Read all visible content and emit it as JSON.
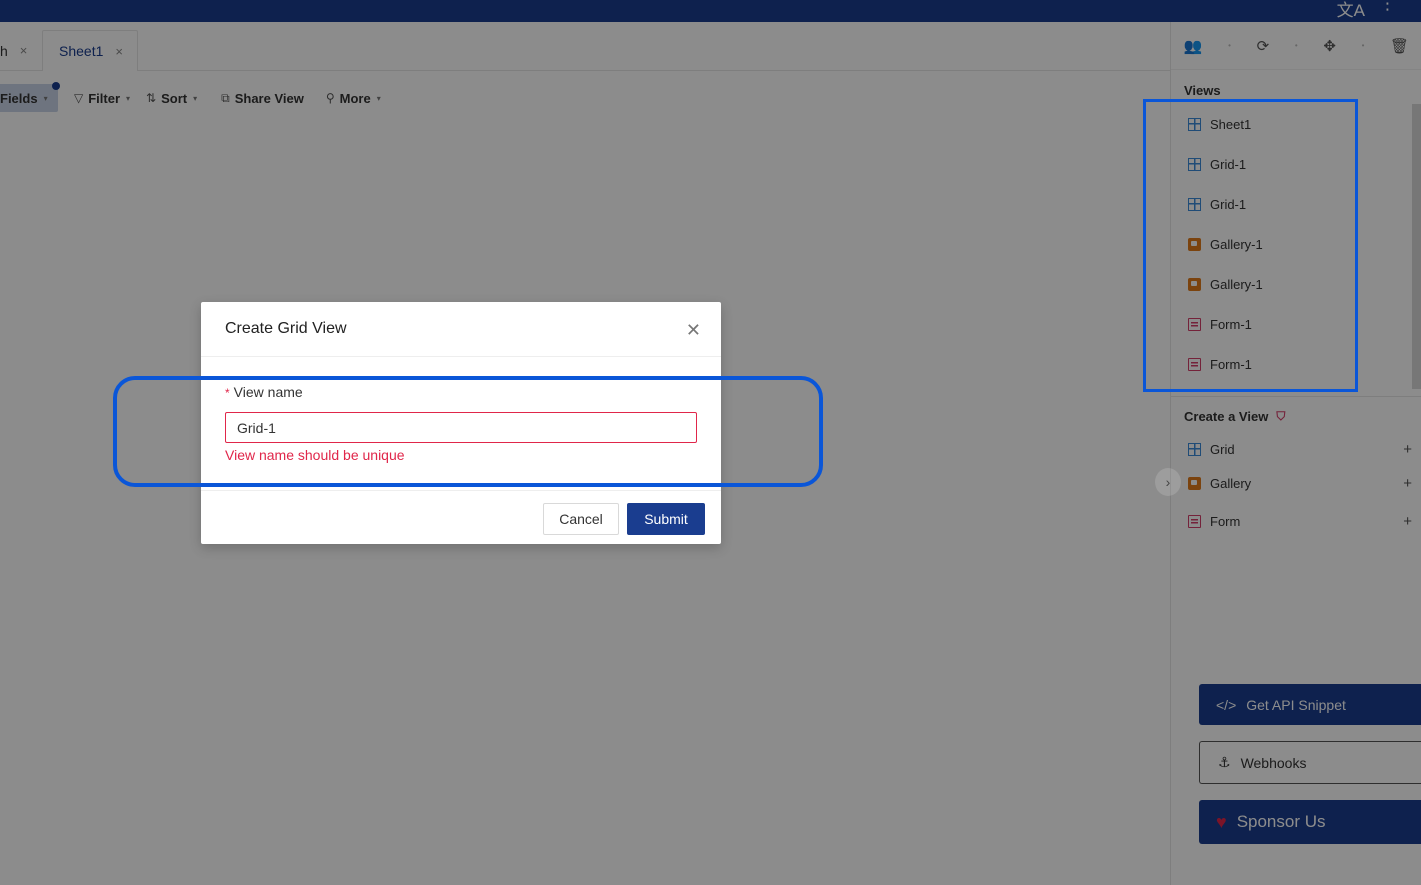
{
  "topbar": {
    "translate_icon": "translate-icon",
    "menu_icon": "more-vertical-icon",
    "translate_glyph": "文A",
    "menu_glyph": "⋮"
  },
  "tabs": {
    "previous_tab_label": "h",
    "active_tab_label": "Sheet1",
    "close_glyph": "×"
  },
  "toolbar": {
    "fields_label": "Fields",
    "filter_label": "Filter",
    "sort_label": "Sort",
    "share_view_label": "Share View",
    "more_label": "More"
  },
  "sidebar": {
    "views_title": "Views",
    "views": [
      {
        "label": "Sheet1",
        "type": "grid"
      },
      {
        "label": "Grid-1",
        "type": "grid"
      },
      {
        "label": "Grid-1",
        "type": "grid"
      },
      {
        "label": "Gallery-1",
        "type": "gallery"
      },
      {
        "label": "Gallery-1",
        "type": "gallery"
      },
      {
        "label": "Form-1",
        "type": "form"
      },
      {
        "label": "Form-1",
        "type": "form"
      }
    ],
    "create_title": "Create a View",
    "create_items": [
      {
        "label": "Grid",
        "type": "grid"
      },
      {
        "label": "Gallery",
        "type": "gallery"
      },
      {
        "label": "Form",
        "type": "form"
      }
    ],
    "api_snippet_label": "Get API Snippet",
    "webhooks_label": "Webhooks",
    "sponsor_label": "Sponsor Us"
  },
  "modal": {
    "title": "Create Grid View",
    "field_label": "View name",
    "required_mark": "*",
    "field_value": "Grid-1",
    "error_text": "View name should be unique",
    "cancel_label": "Cancel",
    "submit_label": "Submit"
  },
  "colors": {
    "brand": "#1a3d8f",
    "error": "#e0264a",
    "highlight": "#0a56d8",
    "grid_icon": "#3b8ad9",
    "gallery_icon": "#e07b1a",
    "form_icon": "#d43f6a"
  }
}
